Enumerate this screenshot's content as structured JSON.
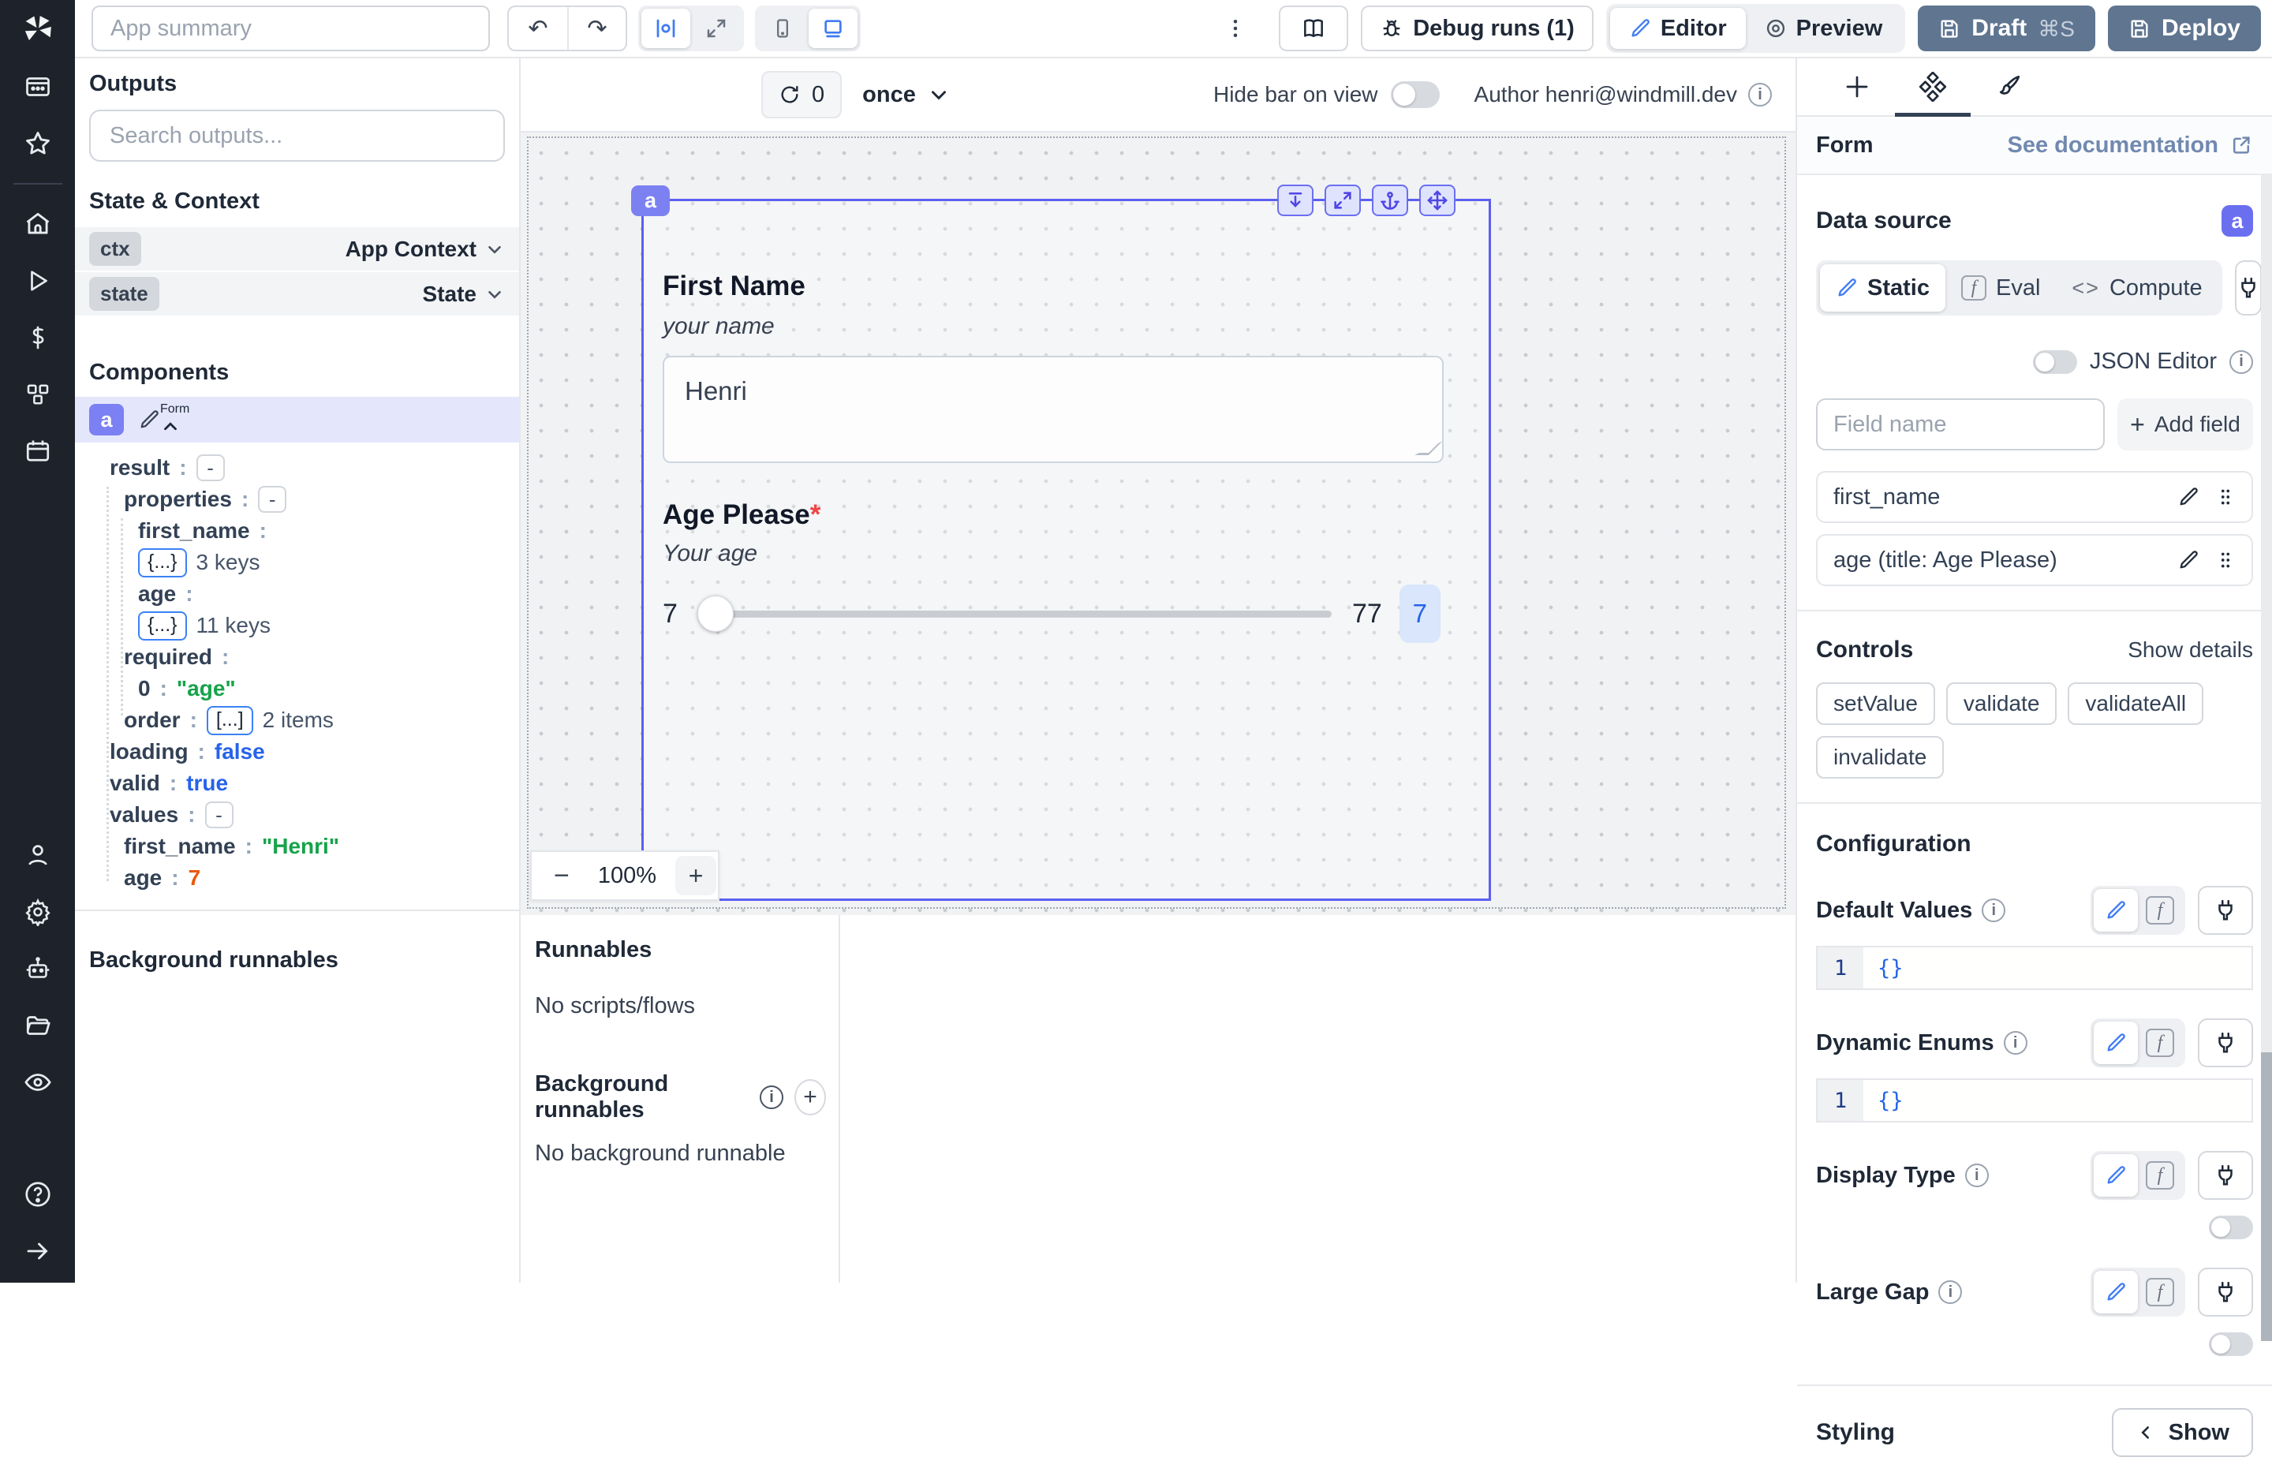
{
  "colors": {
    "accent": "#6366f1",
    "selection": "#5b5ff0",
    "slate_button": "#5f7590",
    "doc_link": "#7189b0",
    "string_value": "#16a34a",
    "bool_value": "#2563eb",
    "number_value": "#ea580c"
  },
  "topbar": {
    "app_summary_placeholder": "App summary",
    "debug_runs": "Debug runs (1)",
    "editor": "Editor",
    "preview": "Preview",
    "draft": "Draft",
    "draft_shortcut": "⌘S",
    "deploy": "Deploy"
  },
  "centerbar": {
    "refresh_count": "0",
    "schedule": "once",
    "hide_bar": "Hide bar on view",
    "author": "Author henri@windmill.dev"
  },
  "outputs": {
    "title": "Outputs",
    "search_placeholder": "Search outputs...",
    "state_context": "State & Context",
    "ctx_badge": "ctx",
    "ctx_label": "App Context",
    "state_badge": "state",
    "state_label": "State",
    "components": "Components",
    "component_badge": "a",
    "component_label": "Form",
    "background": "Background runnables",
    "tree": [
      {
        "pad": 22,
        "key": "result",
        "colon": ":",
        "btn": "-"
      },
      {
        "pad": 40,
        "key": "properties",
        "colon": ":",
        "btn": "-"
      },
      {
        "pad": 58,
        "key": "first_name",
        "colon": ":"
      },
      {
        "pad": 58,
        "chip": "{...}",
        "suffix": "3 keys"
      },
      {
        "pad": 58,
        "key": "age",
        "colon": ":"
      },
      {
        "pad": 58,
        "chip": "{...}",
        "suffix": "11 keys"
      },
      {
        "pad": 40,
        "key": "required",
        "colon": ":"
      },
      {
        "pad": 58,
        "key": "0",
        "colon": ":",
        "value": "\"age\"",
        "cls": "string"
      },
      {
        "pad": 40,
        "key": "order",
        "colon": ":",
        "chip": "[...]",
        "suffix": "2 items"
      },
      {
        "pad": 22,
        "key": "loading",
        "colon": ":",
        "value": "false",
        "cls": "bool"
      },
      {
        "pad": 22,
        "key": "valid",
        "colon": ":",
        "value": "true",
        "cls": "bool"
      },
      {
        "pad": 22,
        "key": "values",
        "colon": ":",
        "btn": "-"
      },
      {
        "pad": 40,
        "key": "first_name",
        "colon": ":",
        "value": "\"Henri\"",
        "cls": "string"
      },
      {
        "pad": 40,
        "key": "age",
        "colon": ":",
        "value": "7",
        "cls": "number"
      }
    ]
  },
  "form": {
    "badge": "a",
    "first_name_label": "First Name",
    "first_name_desc": "your name",
    "first_name_value": "Henri",
    "age_label": "Age Please",
    "required_star": "*",
    "age_desc": "Your age",
    "slider_min": "7",
    "slider_max": "77",
    "slider_value": "7",
    "zoom_minus": "−",
    "zoom_level": "100%",
    "zoom_plus": "+"
  },
  "runnables": {
    "title": "Runnables",
    "empty": "No scripts/flows",
    "bg_title": "Background runnables",
    "bg_empty": "No background runnable",
    "info": "i",
    "add": "+"
  },
  "right": {
    "header": {
      "title": "Form",
      "doc": "See documentation"
    },
    "data_source": {
      "label": "Data source",
      "badge": "a",
      "static": "Static",
      "eval": "Eval",
      "compute_glyph": "<>",
      "compute": "Compute",
      "json_editor": "JSON Editor",
      "field_placeholder": "Field name",
      "add_plus": "+",
      "add_field": "Add field",
      "fx": "f"
    },
    "fields": [
      {
        "label": "first_name"
      },
      {
        "label": "age (title: Age Please)"
      }
    ],
    "controls": {
      "title": "Controls",
      "show_details": "Show details",
      "pills": [
        {
          "label": "setValue"
        },
        {
          "label": "validate"
        },
        {
          "label": "validateAll"
        },
        {
          "label": "invalidate"
        }
      ]
    },
    "config": {
      "title": "Configuration",
      "default_values": "Default Values",
      "dynamic_enums": "Dynamic Enums",
      "display_type": "Display Type",
      "large_gap": "Large Gap",
      "line_no": "1",
      "code_value": "{}",
      "info": "i"
    },
    "styling": {
      "title": "Styling",
      "show": "Show"
    }
  }
}
